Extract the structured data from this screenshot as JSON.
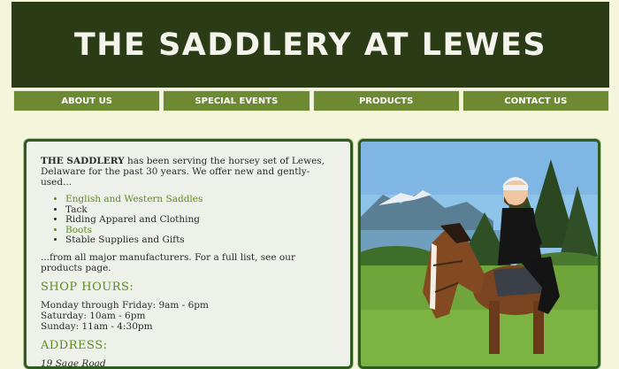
{
  "header": {
    "title": "THE SADDLERY AT LEWES"
  },
  "nav": {
    "items": [
      {
        "label": "ABOUT US"
      },
      {
        "label": "SPECIAL EVENTS"
      },
      {
        "label": "PRODUCTS"
      },
      {
        "label": "CONTACT US"
      }
    ]
  },
  "main": {
    "intro_name": "THE SADDLERY",
    "intro_rest": " has been serving the horsey set of Lewes, Delaware for the past 30 years. We offer new and gently-used...",
    "list": [
      {
        "label": "English and Western Saddles"
      },
      {
        "label": "Tack"
      },
      {
        "label": "Riding Apparel and Clothing"
      },
      {
        "label": "Boots"
      },
      {
        "label": "Stable Supplies and Gifts"
      }
    ],
    "outro": "...from all major manufacturers. For a full list, see our products page.",
    "hours_heading": "SHOP HOURS:",
    "hours": [
      "Monday through Friday: 9am - 6pm",
      "Saturday: 10am - 6pm",
      "Sunday: 11am - 4:30pm"
    ],
    "address_heading": "ADDRESS:",
    "address_line1": "19 Sage Road"
  },
  "colors": {
    "banner": "#2b3b15",
    "nav": "#6d8a32",
    "accent_green": "#5f8a1e",
    "page_bg": "#f5f5dc"
  }
}
